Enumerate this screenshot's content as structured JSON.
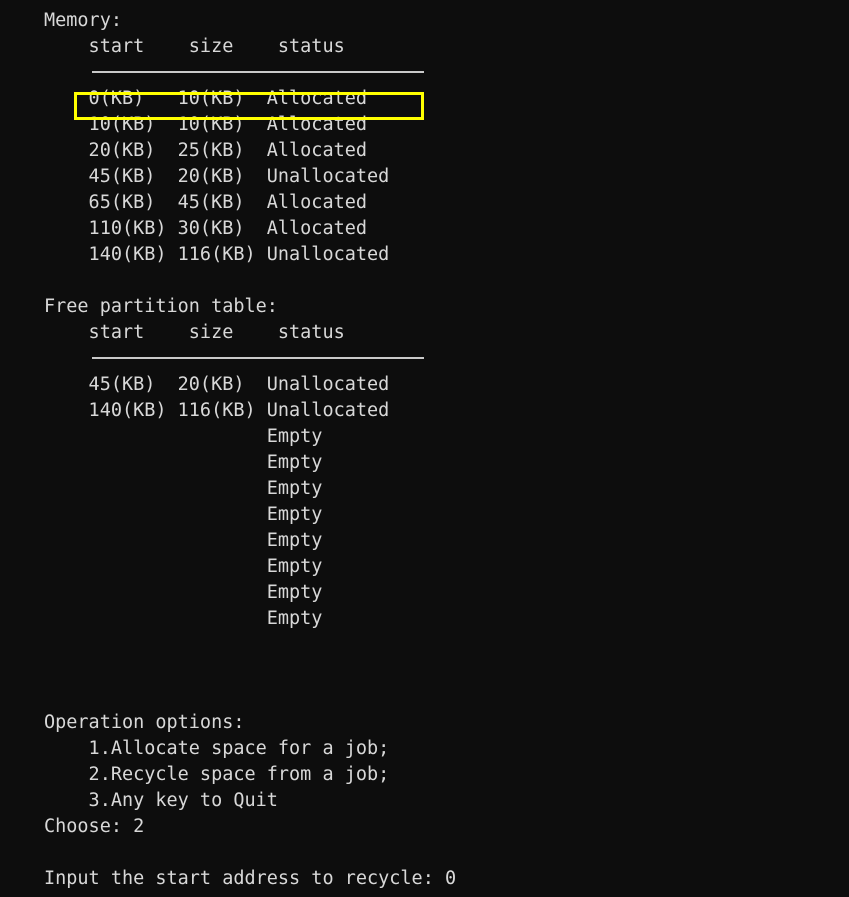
{
  "terminal": {
    "background_color": "#0d0d0d",
    "text_color": "#d8d8d8",
    "highlight_color": "#ffff00",
    "rule_color": "#c9c9c9"
  },
  "memory_section": {
    "title": "Memory:",
    "columns": [
      "start",
      "size",
      "status"
    ],
    "header_line": "    start    size    status",
    "rows": [
      {
        "start": "0(KB)",
        "size": "10(KB)",
        "status": "Allocated",
        "text": "    0(KB)   10(KB)  Allocated",
        "highlighted": true
      },
      {
        "start": "10(KB)",
        "size": "10(KB)",
        "status": "Allocated",
        "text": "    10(KB)  10(KB)  Allocated",
        "highlighted": false
      },
      {
        "start": "20(KB)",
        "size": "25(KB)",
        "status": "Allocated",
        "text": "    20(KB)  25(KB)  Allocated",
        "highlighted": false
      },
      {
        "start": "45(KB)",
        "size": "20(KB)",
        "status": "Unallocated",
        "text": "    45(KB)  20(KB)  Unallocated",
        "highlighted": false
      },
      {
        "start": "65(KB)",
        "size": "45(KB)",
        "status": "Allocated",
        "text": "    65(KB)  45(KB)  Allocated",
        "highlighted": false
      },
      {
        "start": "110(KB)",
        "size": "30(KB)",
        "status": "Allocated",
        "text": "    110(KB) 30(KB)  Allocated",
        "highlighted": false
      },
      {
        "start": "140(KB)",
        "size": "116(KB)",
        "status": "Unallocated",
        "text": "    140(KB) 116(KB) Unallocated",
        "highlighted": false
      }
    ]
  },
  "free_partition_section": {
    "title": "Free partition table:",
    "columns": [
      "start",
      "size",
      "status"
    ],
    "header_line": "    start    size    status",
    "rows": [
      {
        "start": "45(KB)",
        "size": "20(KB)",
        "status": "Unallocated",
        "text": "    45(KB)  20(KB)  Unallocated"
      },
      {
        "start": "140(KB)",
        "size": "116(KB)",
        "status": "Unallocated",
        "text": "    140(KB) 116(KB) Unallocated"
      },
      {
        "start": "",
        "size": "",
        "status": "Empty",
        "text": "                    Empty"
      },
      {
        "start": "",
        "size": "",
        "status": "Empty",
        "text": "                    Empty"
      },
      {
        "start": "",
        "size": "",
        "status": "Empty",
        "text": "                    Empty"
      },
      {
        "start": "",
        "size": "",
        "status": "Empty",
        "text": "                    Empty"
      },
      {
        "start": "",
        "size": "",
        "status": "Empty",
        "text": "                    Empty"
      },
      {
        "start": "",
        "size": "",
        "status": "Empty",
        "text": "                    Empty"
      },
      {
        "start": "",
        "size": "",
        "status": "Empty",
        "text": "                    Empty"
      },
      {
        "start": "",
        "size": "",
        "status": "Empty",
        "text": "                    Empty"
      }
    ]
  },
  "operations_section": {
    "title": "Operation options:",
    "options": [
      {
        "text": "    1.Allocate space for a job;"
      },
      {
        "text": "    2.Recycle space from a job;"
      },
      {
        "text": "    3.Any key to Quit"
      }
    ],
    "choose_prompt_line": "Choose: 2",
    "choose_label": "Choose: ",
    "choose_value": "2"
  },
  "input_prompt": {
    "line": "Input the start address to recycle: 0",
    "label": "Input the start address to recycle: ",
    "value": "0"
  }
}
